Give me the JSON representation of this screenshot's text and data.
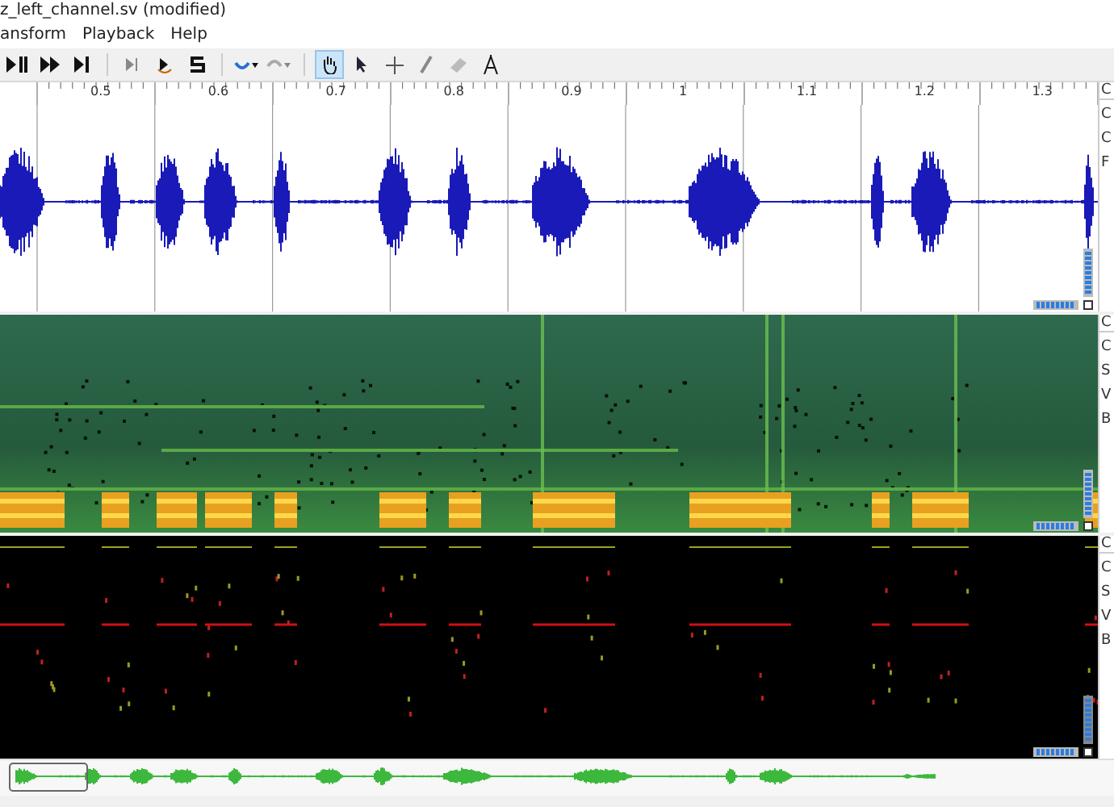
{
  "window": {
    "title": "z_left_channel.sv (modified)"
  },
  "menu": [
    "ansform",
    "Playback",
    "Help"
  ],
  "toolbar": [
    [
      {
        "kind": "play"
      },
      {
        "kind": "ffwd"
      },
      {
        "kind": "end"
      }
    ],
    [
      {
        "kind": "playsel"
      },
      {
        "kind": "loop"
      },
      {
        "kind": "solo"
      }
    ],
    [
      {
        "kind": "undo"
      },
      {
        "kind": "redo"
      }
    ]
  ],
  "tools": [
    {
      "kind": "navigate",
      "selected": true
    },
    {
      "kind": "select",
      "selected": false
    },
    {
      "kind": "move",
      "selected": false
    },
    {
      "kind": "draw",
      "selected": false
    },
    {
      "kind": "erase",
      "selected": false
    },
    {
      "kind": "measure",
      "selected": false
    }
  ],
  "ruler": [
    "0.5",
    "0.6",
    "0.7",
    "0.8",
    "0.9",
    "1",
    "1.1",
    "1.2",
    "1.3"
  ],
  "panes": [
    {
      "kind": "waveform",
      "tab": "C",
      "properties": [
        "C",
        "C",
        "F"
      ]
    },
    {
      "kind": "spectrogram",
      "tab": "C",
      "properties": [
        "C",
        "S",
        "V",
        "B"
      ]
    },
    {
      "kind": "pitch",
      "tab": "C",
      "properties": [
        "C",
        "S",
        "V",
        "B"
      ]
    }
  ]
}
